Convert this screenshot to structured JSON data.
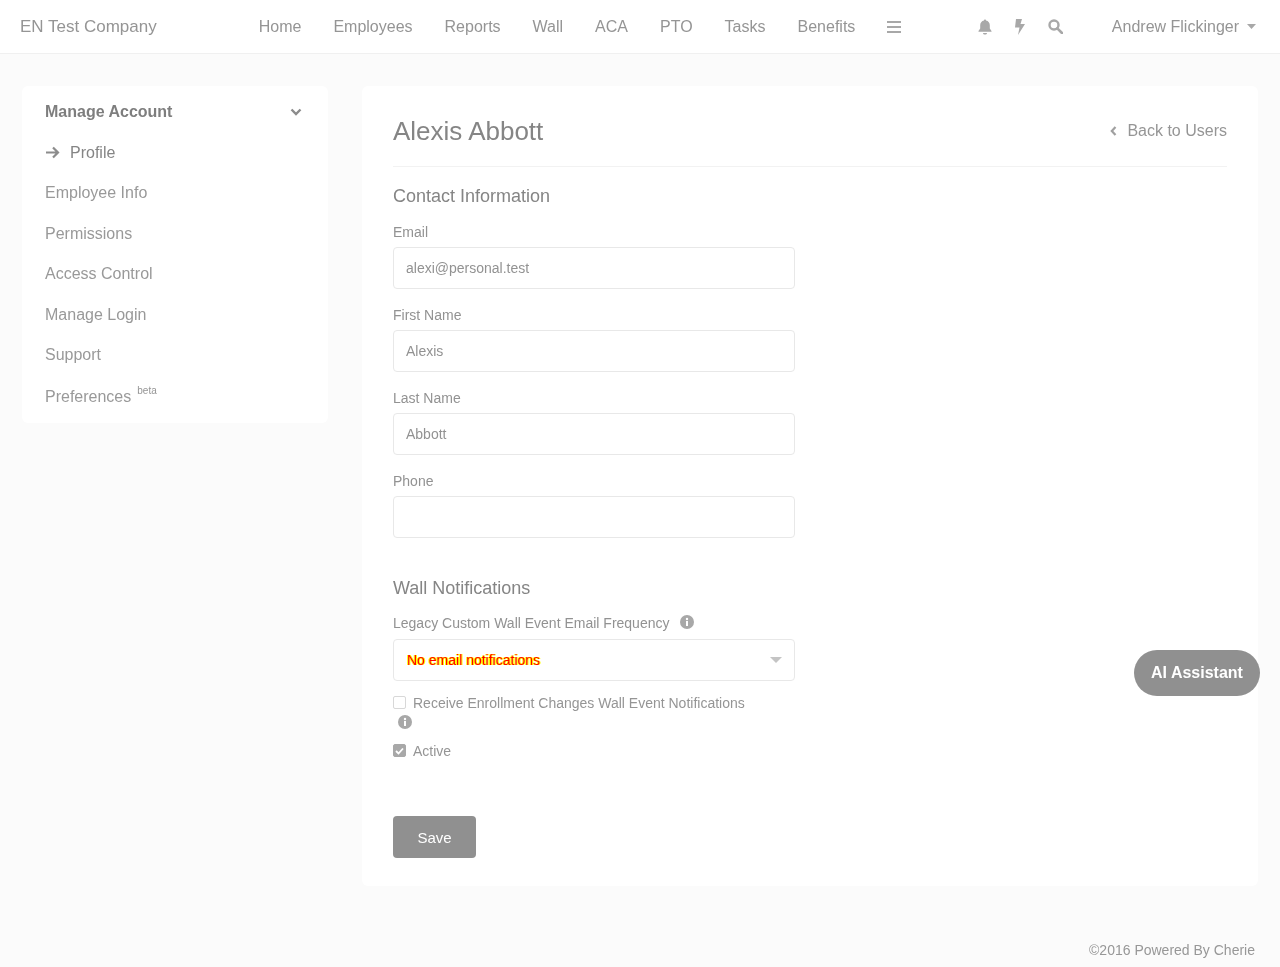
{
  "navbar": {
    "company": "EN Test Company",
    "links": [
      "Home",
      "Employees",
      "Reports",
      "Wall",
      "ACA",
      "PTO",
      "Tasks",
      "Benefits"
    ],
    "user": "Andrew Flickinger"
  },
  "sidebar": {
    "title": "Manage Account",
    "expanded": true,
    "items": [
      {
        "label": "Profile",
        "selected": true
      },
      {
        "label": "Employee Info",
        "selected": false
      },
      {
        "label": "Permissions",
        "selected": false
      },
      {
        "label": "Access Control",
        "selected": false
      },
      {
        "label": "Manage Login",
        "selected": false
      },
      {
        "label": "Support",
        "selected": false
      },
      {
        "label": "Preferences",
        "selected": false,
        "badge": "beta"
      }
    ]
  },
  "profile": {
    "name": "Alexis Abbott",
    "back_link": "Back to Users",
    "section_title": "Contact Information",
    "fields": [
      {
        "label": "Email",
        "value": "alexi@personal.test"
      },
      {
        "label": "First Name",
        "value": "Alexis"
      },
      {
        "label": "Last Name",
        "value": "Abbott"
      },
      {
        "label": "Phone"
      }
    ]
  },
  "wall_notifications": {
    "title": "Wall Notifications",
    "frequency": {
      "label": "Legacy Custom Wall Event Email Frequency",
      "value": "No email notifications"
    },
    "checkboxes": [
      {
        "label": "Receive Enrollment Changes Wall Event Notifications",
        "checked": false,
        "info": true
      },
      {
        "label": "Active",
        "checked": true,
        "info": false
      }
    ]
  },
  "save_button": "Save",
  "assistant_button": "AI Assistant",
  "footer": "©2016 Powered By Cherie"
}
